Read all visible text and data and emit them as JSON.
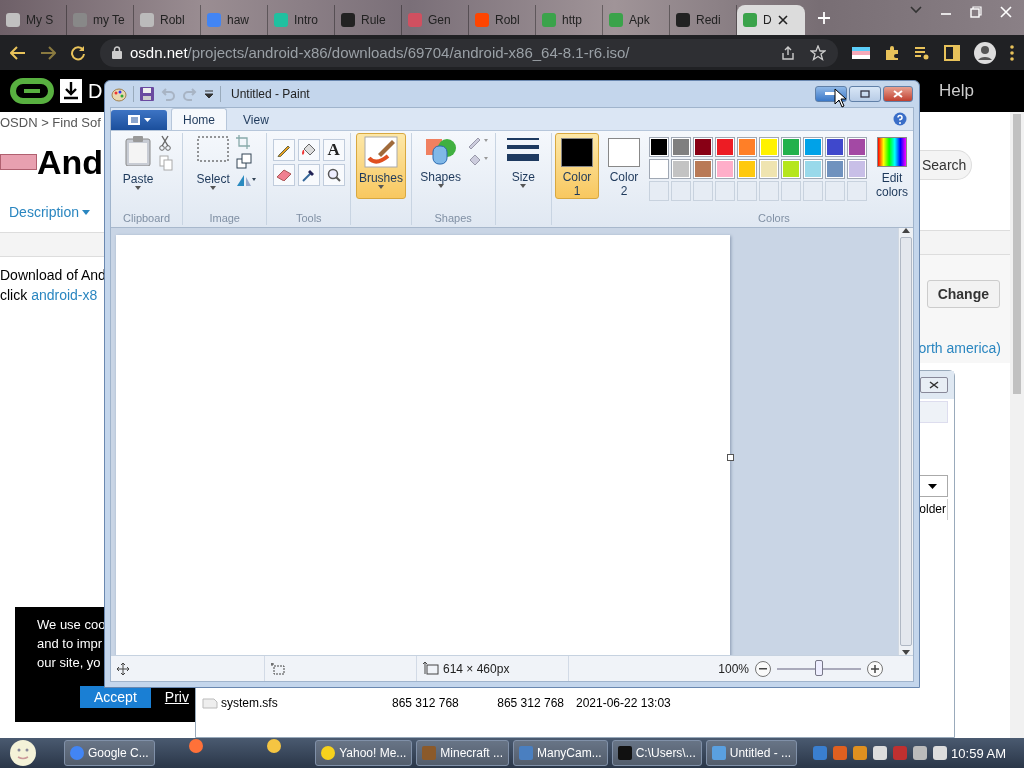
{
  "browser": {
    "tabs": [
      {
        "label": "My S",
        "selected": false
      },
      {
        "label": "my Te",
        "selected": false
      },
      {
        "label": "Robl",
        "selected": false
      },
      {
        "label": "haw",
        "selected": false
      },
      {
        "label": "Intro",
        "selected": false
      },
      {
        "label": "Rule",
        "selected": false
      },
      {
        "label": "Gen",
        "selected": false
      },
      {
        "label": "Robl",
        "selected": false
      },
      {
        "label": "http",
        "selected": false
      },
      {
        "label": "Apk",
        "selected": false
      },
      {
        "label": "Redi",
        "selected": false
      },
      {
        "label": "D",
        "selected": true
      }
    ],
    "url": {
      "host": "osdn.net",
      "path": "/projects/android-x86/downloads/69704/android-x86_64-8.1-r6.iso/"
    }
  },
  "page": {
    "header": {
      "menu_item": "D",
      "help": "Help"
    },
    "breadcrumb": "OSDN > Find Sof",
    "title": "And",
    "description_tab": "Description",
    "intro": "Download of And",
    "click_text": "click",
    "file_link": "android-x8",
    "search_button": "Search",
    "change_button": "Change",
    "region_link": "orth america)",
    "cookie": {
      "lines": [
        "We use coo",
        "and to impr",
        "our site, yo"
      ],
      "accept": "Accept",
      "privacy_link": "Priv"
    }
  },
  "dialog": {
    "column_header": "older",
    "file_row": {
      "name": "system.sfs",
      "column_2": "865 312 768",
      "column_3": "865 312 768",
      "column_4": "2021-06-22 13:03"
    }
  },
  "paint": {
    "title": "Untitled - Paint",
    "tabs": [
      {
        "label": "Home",
        "selected": true
      },
      {
        "label": "View",
        "selected": false
      }
    ],
    "groups": {
      "clipboard": "Clipboard",
      "paste": "Paste",
      "image": "Image",
      "select": "Select",
      "tools": "Tools",
      "text_tool": "A",
      "shapes": "Shapes",
      "shapes_label": "Shapes",
      "size": "Size",
      "colors": "Colors",
      "edit_colors": "Edit colors"
    },
    "brushes": {
      "label": "Brushes",
      "selected": true
    },
    "color_slots": [
      {
        "label": "Color",
        "number": "1",
        "color": "#000000",
        "selected": true
      },
      {
        "label": "Color",
        "number": "2",
        "color": "#ffffff",
        "selected": false
      }
    ],
    "palette": [
      {
        "kind": "swatch",
        "color": "#000000"
      },
      {
        "kind": "swatch",
        "color": "#7f7f7f"
      },
      {
        "kind": "swatch",
        "color": "#880015"
      },
      {
        "kind": "swatch",
        "color": "#ed1c24"
      },
      {
        "kind": "swatch",
        "color": "#ff7f27"
      },
      {
        "kind": "swatch",
        "color": "#fff200"
      },
      {
        "kind": "swatch",
        "color": "#22b14c"
      },
      {
        "kind": "swatch",
        "color": "#00a2e8"
      },
      {
        "kind": "swatch",
        "color": "#3f48cc"
      },
      {
        "kind": "swatch",
        "color": "#a349a4"
      },
      {
        "kind": "swatch",
        "color": "#ffffff"
      },
      {
        "kind": "swatch",
        "color": "#c3c3c3"
      },
      {
        "kind": "swatch",
        "color": "#b97a57"
      },
      {
        "kind": "swatch",
        "color": "#ffaec9"
      },
      {
        "kind": "swatch",
        "color": "#ffc90e"
      },
      {
        "kind": "swatch",
        "color": "#efe4b0"
      },
      {
        "kind": "swatch",
        "color": "#b5e61d"
      },
      {
        "kind": "swatch",
        "color": "#99d9ea"
      },
      {
        "kind": "swatch",
        "color": "#7092be"
      },
      {
        "kind": "swatch",
        "color": "#c8bfe7"
      },
      {
        "kind": "empty"
      },
      {
        "kind": "empty"
      },
      {
        "kind": "empty"
      },
      {
        "kind": "empty"
      },
      {
        "kind": "empty"
      },
      {
        "kind": "empty"
      },
      {
        "kind": "empty"
      },
      {
        "kind": "empty"
      },
      {
        "kind": "empty"
      },
      {
        "kind": "empty"
      }
    ],
    "status": {
      "image_size": "614 × 460px",
      "zoom": "100%",
      "zoom_slider": {
        "level": 0.5
      }
    }
  },
  "taskbar": {
    "items": [
      {
        "kind": "window",
        "label": "Google C..."
      },
      {
        "kind": "pinned"
      },
      {
        "kind": "pinned"
      },
      {
        "kind": "window",
        "label": "Yahoo! Me..."
      },
      {
        "kind": "window",
        "label": "Minecraft ..."
      },
      {
        "kind": "window",
        "label": "ManyCam..."
      },
      {
        "kind": "window",
        "label": "C:\\Users\\..."
      },
      {
        "kind": "window",
        "label": "Untitled - ..."
      }
    ],
    "clock": "10:59 AM"
  }
}
